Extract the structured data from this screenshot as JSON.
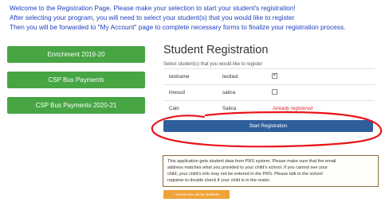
{
  "intro": {
    "line1": "Welcome to the Registration Page. Please make your selection to start your student's registration!",
    "line2": "After selecting your program, you will need to select your student(s) that you would like to register",
    "line3": "Then you will be forwarded to \"My Account\" page to complete necessary forms to finalize your registration process."
  },
  "programs": [
    {
      "label": "Enrichment 2019-20"
    },
    {
      "label": "CSP Bus Payments"
    },
    {
      "label": "CSP Bus Payments 2020-21"
    }
  ],
  "registration": {
    "title": "Student Registration",
    "subtitle": "Select student(s) that you would like to register",
    "students": [
      {
        "first": "testname",
        "last": "testlast",
        "checked": true,
        "status": ""
      },
      {
        "first": "imesud",
        "last": "saitca",
        "checked": false,
        "status": ""
      },
      {
        "first": "Cain",
        "last": "Saitca",
        "checked": false,
        "status": "Already registered"
      }
    ],
    "start_label": "Start Registration"
  },
  "info": {
    "line1": "This application gets student data from PRS system. Please make sure that the email",
    "line2": "address matches what you provided to your child's school. If you cannot see your",
    "line3": "child, your child's info may not be entered in the PRS. Please talk to the school",
    "line4": "registrar to double check if your child is in the roster.",
    "button_label": "I cannot see all my students"
  },
  "colors": {
    "intro_text": "#1d3fbf",
    "program_button": "#47a544",
    "start_button": "#2f5f9b",
    "annotation": "#e8151b",
    "already_registered": "#d9332b",
    "cannot_button": "#f0a33a"
  }
}
